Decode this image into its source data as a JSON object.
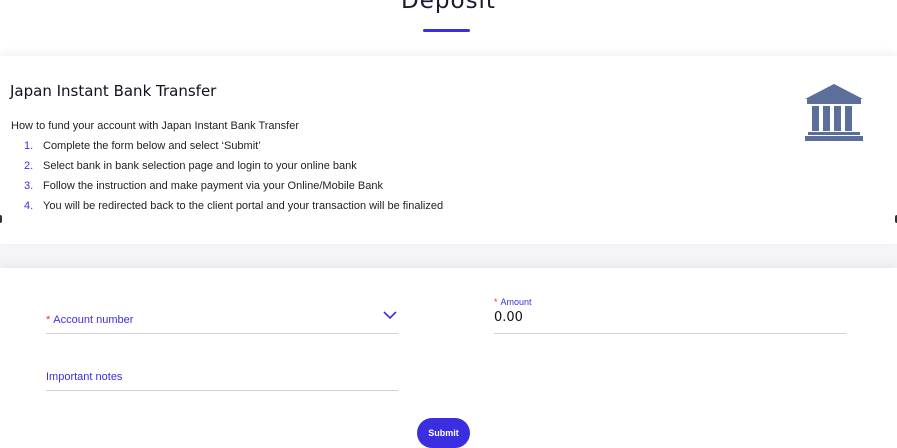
{
  "header": {
    "title": "Deposit"
  },
  "method": {
    "title": "Japan Instant Bank Transfer",
    "howto": "How to fund your account with Japan Instant Bank Transfer",
    "steps": [
      {
        "num": "1.",
        "text": "Complete the form below and select ‘Submit’"
      },
      {
        "num": "2.",
        "text": "Select bank in bank selection page and login to your online bank"
      },
      {
        "num": "3.",
        "text": "Follow the instruction and make payment via your Online/Mobile Bank"
      },
      {
        "num": "4.",
        "text": "You will be redirected back to the client portal and your transaction will be finalized"
      }
    ],
    "icon": "bank-icon"
  },
  "form": {
    "account": {
      "required_mark": "*",
      "label": "Account number"
    },
    "amount": {
      "required_mark": "*",
      "label": "Amount",
      "value": "0.00"
    },
    "notes": {
      "label": "Important notes"
    },
    "submit_label": "Submit"
  },
  "colors": {
    "accent": "#3b2ee0",
    "required": "#e53935",
    "icon": "#5b6f9a"
  }
}
